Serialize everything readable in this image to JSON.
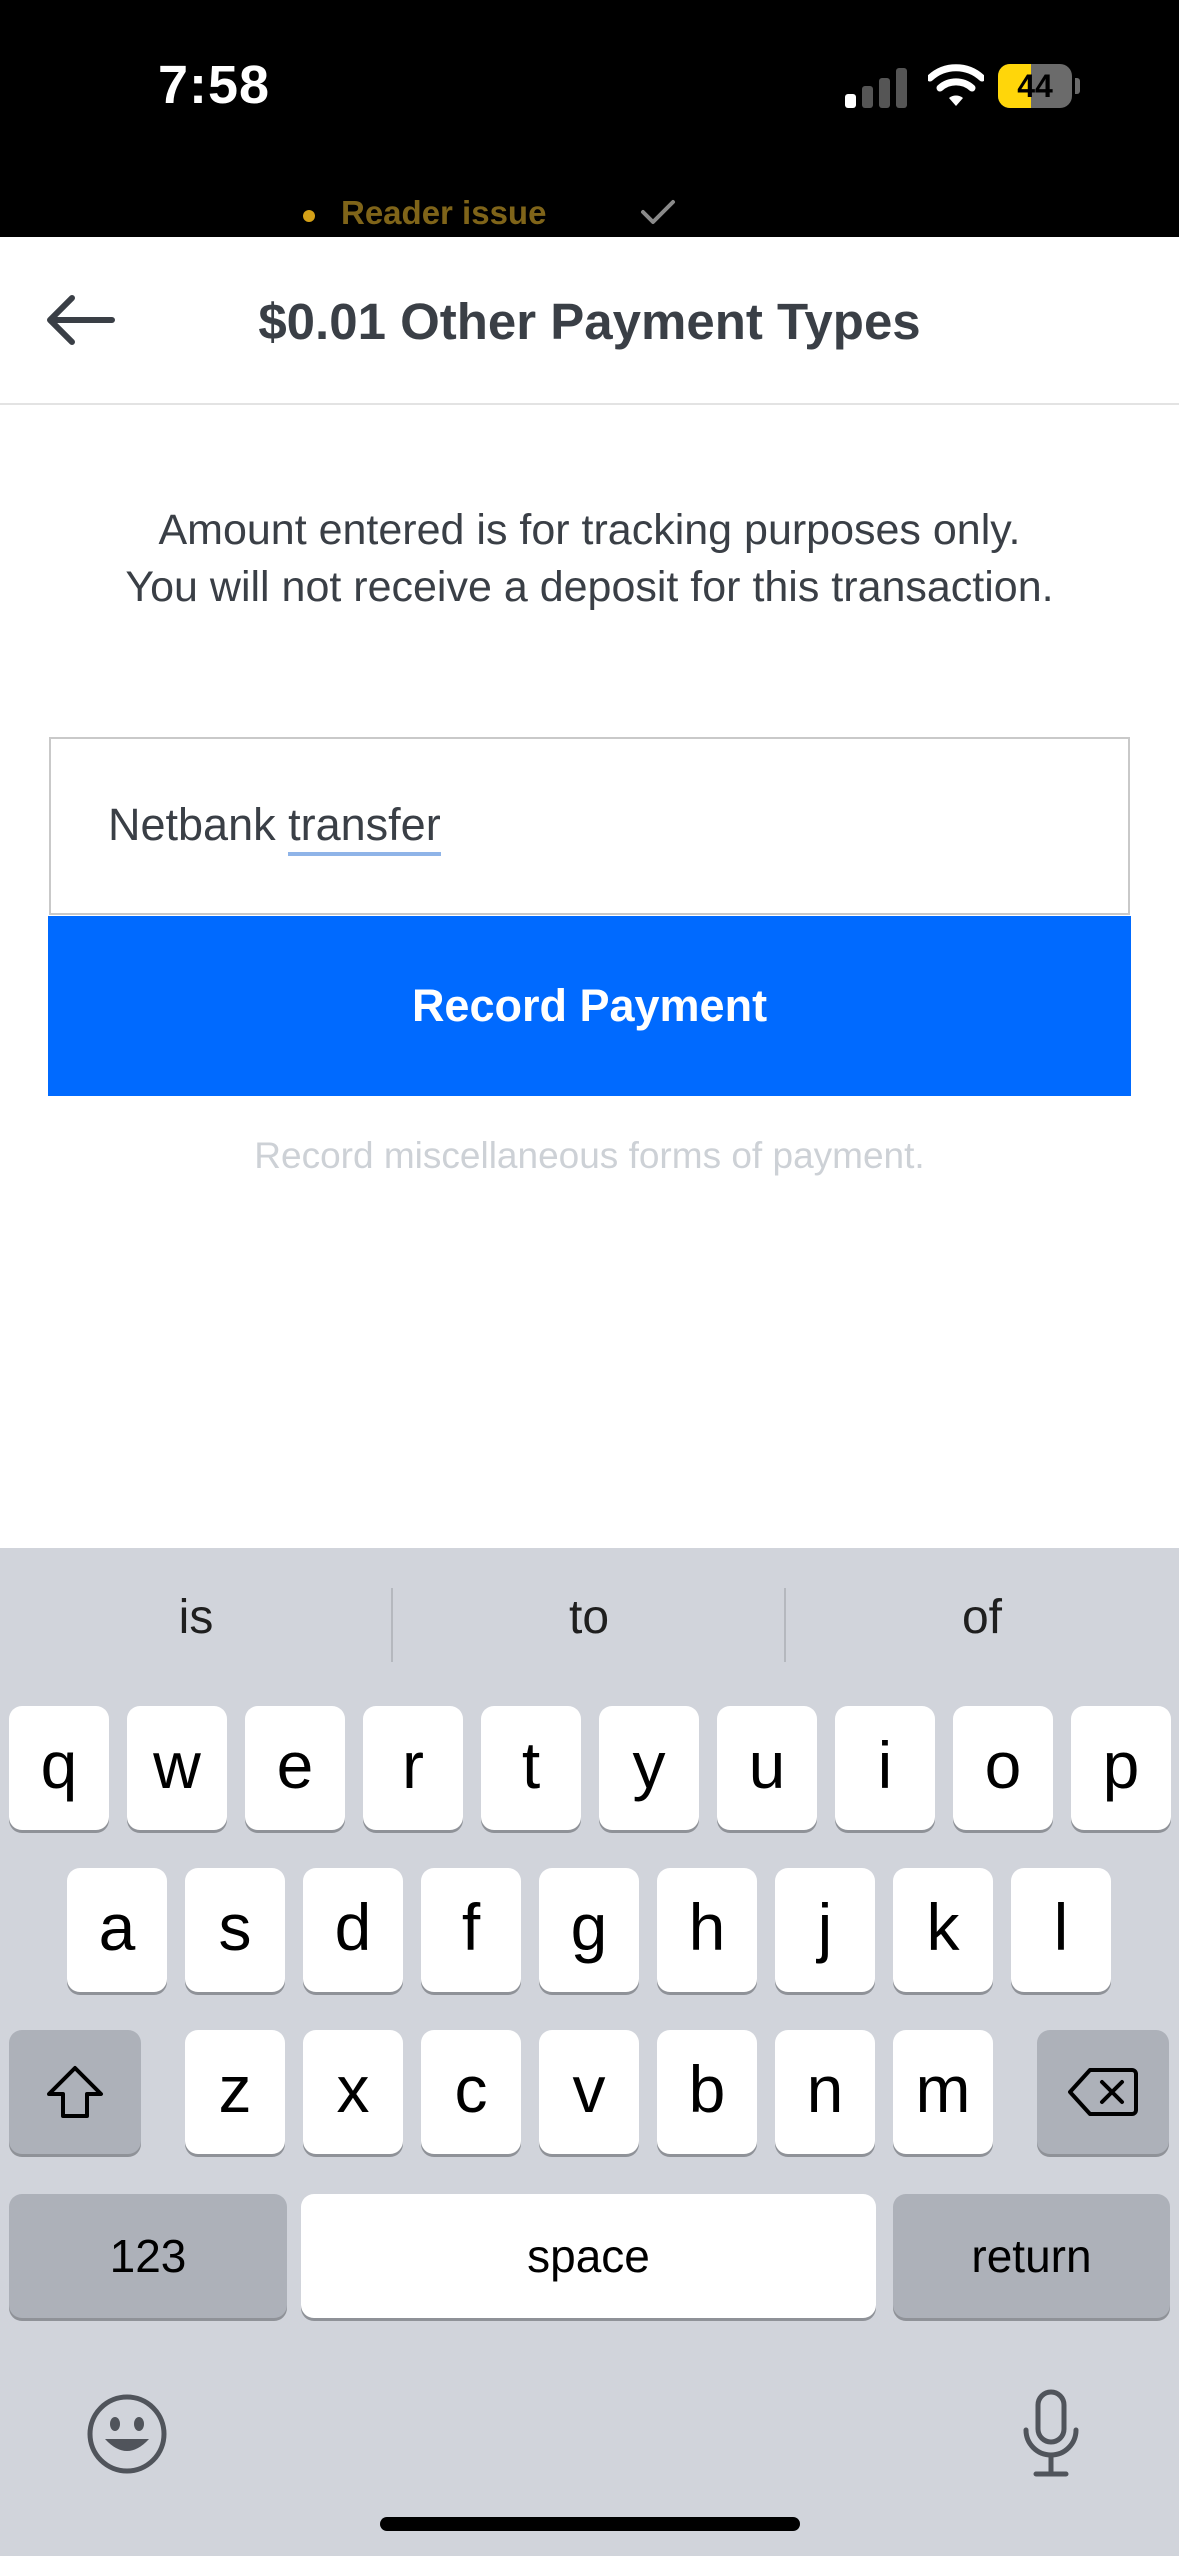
{
  "status_bar": {
    "time": "7:58",
    "battery": "44",
    "battery_level": 0.44
  },
  "reader": {
    "text": "Reader issue"
  },
  "header": {
    "title": "$0.01 Other Payment Types"
  },
  "info": {
    "line1": "Amount entered is for tracking purposes only.",
    "line2": "You will not receive a deposit for this transaction."
  },
  "note_input": {
    "value_prefix": "Netbank ",
    "value_underlined": "transfer"
  },
  "record_button": {
    "label": "Record Payment"
  },
  "hint": "Record miscellaneous forms of payment.",
  "keyboard": {
    "suggestions": [
      "is",
      "to",
      "of"
    ],
    "row1": [
      "q",
      "w",
      "e",
      "r",
      "t",
      "y",
      "u",
      "i",
      "o",
      "p"
    ],
    "row2": [
      "a",
      "s",
      "d",
      "f",
      "g",
      "h",
      "j",
      "k",
      "l"
    ],
    "row3": [
      "z",
      "x",
      "c",
      "v",
      "b",
      "n",
      "m"
    ],
    "numbers_key": "123",
    "space_key": "space",
    "return_key": "return"
  },
  "colors": {
    "accent": "#006aff",
    "keyboard_bg": "#d1d4db",
    "warning": "#d4a017"
  }
}
